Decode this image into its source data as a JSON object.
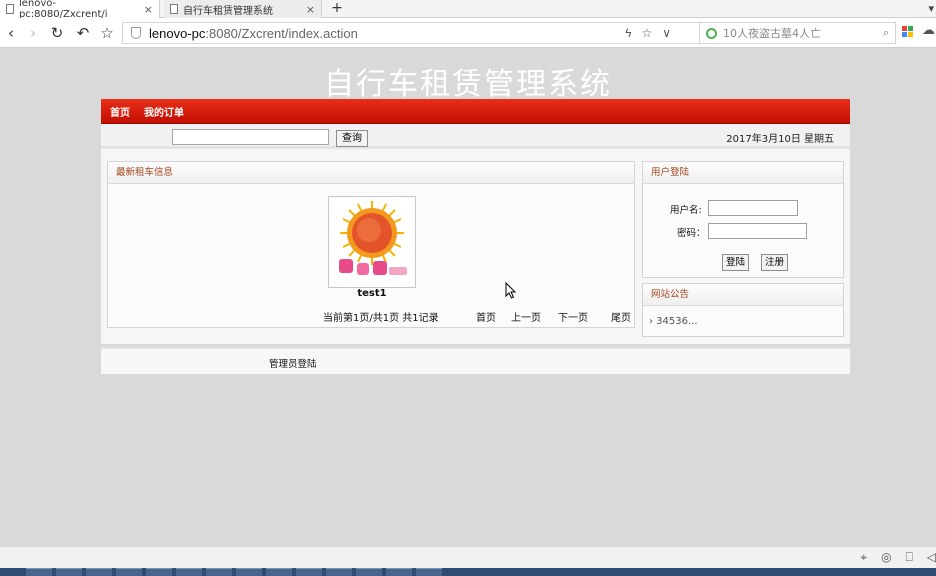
{
  "browser": {
    "tabs": [
      {
        "title": "lenovo-pc:8080/Zxcrent/i",
        "close": "×"
      },
      {
        "title": "自行车租赁管理系统",
        "close": "×"
      }
    ],
    "new_tab": "+",
    "url_host": "lenovo-pc",
    "url_path": ":8080/Zxcrent/index.action",
    "search_text": "10人夜盗古墓4人亡"
  },
  "site": {
    "title": "自行车租赁管理系统",
    "menu": [
      "首页",
      "我的订单"
    ],
    "search_button": "查询",
    "date": "2017年3月10日 星期五"
  },
  "latest": {
    "heading": "最新租车信息",
    "item_name": "test1",
    "pager_info": "当前第1页/共1页  共1记录",
    "pager_links": [
      "首页",
      "上一页",
      "下一页",
      "尾页"
    ]
  },
  "login": {
    "heading": "用户登陆",
    "username_label": "用户名:",
    "password_label": "密码：",
    "login_button": "登陆",
    "register_button": "注册"
  },
  "notice": {
    "heading": "网站公告",
    "items": [
      "› 34536..."
    ]
  },
  "footer": {
    "admin_link": "管理员登陆"
  },
  "colors": {
    "menu_red": "#d61f0b",
    "panel_heading": "#a3461b"
  }
}
